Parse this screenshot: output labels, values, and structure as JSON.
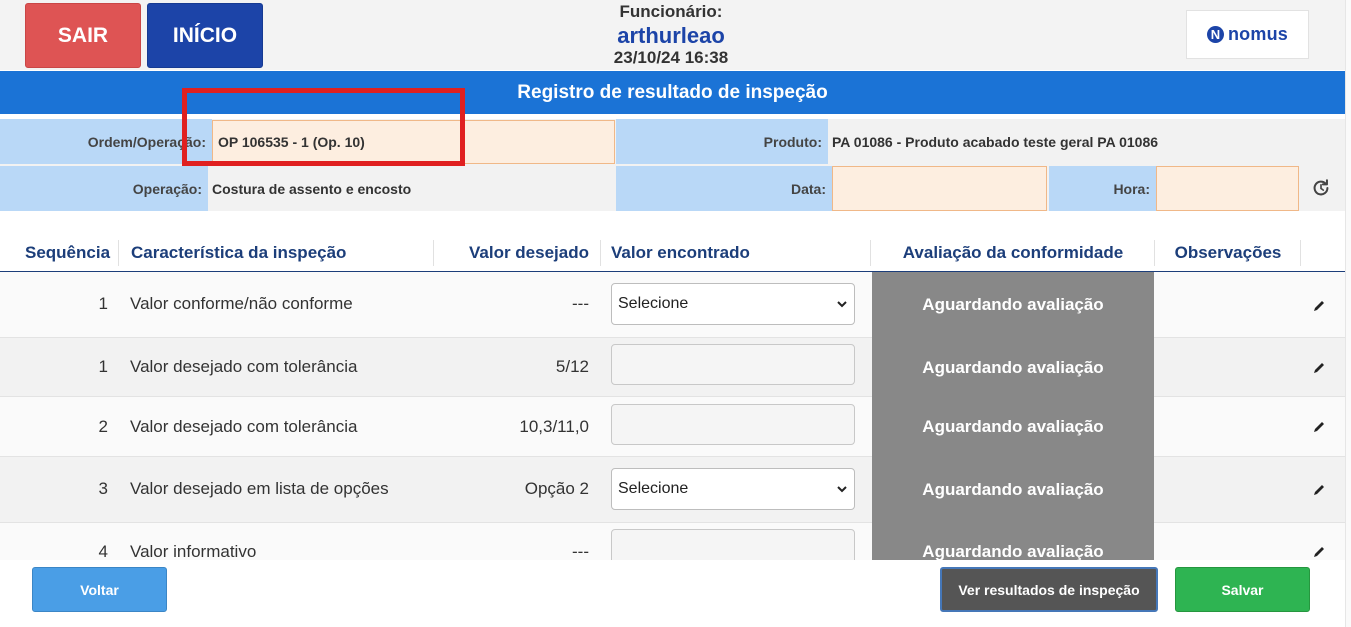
{
  "header": {
    "exit_label": "SAIR",
    "home_label": "INÍCIO",
    "employee_label": "Funcionário:",
    "employee_name": "arthurleao",
    "datetime": "23/10/24 16:38",
    "logo_text": "nomus",
    "logo_mark": "N"
  },
  "title": "Registro de resultado de inspeção",
  "info": {
    "order_label": "Ordem/Operação:",
    "order_value": "OP 106535 - 1 (Op. 10)",
    "product_label": "Produto:",
    "product_value": "PA 01086 - Produto acabado teste geral PA 01086",
    "operation_label": "Operação:",
    "operation_value": "Costura de assento e encosto",
    "date_label": "Data:",
    "date_value": "",
    "time_label": "Hora:",
    "time_value": ""
  },
  "table": {
    "headers": {
      "seq": "Sequência",
      "char": "Característica da inspeção",
      "desired": "Valor desejado",
      "found": "Valor encontrado",
      "eval": "Avaliação da conformidade",
      "obs": "Observações"
    },
    "rows": [
      {
        "seq": "1",
        "char": "Valor conforme/não conforme",
        "desired": "---",
        "input": "select",
        "found": "Selecione",
        "eval": "Aguardando avaliação"
      },
      {
        "seq": "1",
        "char": "Valor desejado com tolerância",
        "desired": "5/12",
        "input": "text",
        "found": "",
        "eval": "Aguardando avaliação"
      },
      {
        "seq": "2",
        "char": "Valor desejado com tolerância",
        "desired": "10,3/11,0",
        "input": "text",
        "found": "",
        "eval": "Aguardando avaliação"
      },
      {
        "seq": "3",
        "char": "Valor desejado em lista de opções",
        "desired": "Opção 2",
        "input": "select",
        "found": "Selecione",
        "eval": "Aguardando avaliação"
      },
      {
        "seq": "4",
        "char": "Valor informativo",
        "desired": "---",
        "input": "text",
        "found": "",
        "eval": "Aguardando avaliação"
      }
    ]
  },
  "footer": {
    "back_label": "Voltar",
    "results_label": "Ver resultados de inspeção",
    "save_label": "Salvar"
  },
  "colors": {
    "exit": "#de5454",
    "home": "#1c44a8",
    "titlebar": "#1b73d6",
    "eval_pending": "#888888",
    "save": "#2eb452",
    "highlight": "#e02020"
  },
  "icons": [
    "refresh-icon",
    "pencil-icon",
    "chevron-down-icon"
  ]
}
